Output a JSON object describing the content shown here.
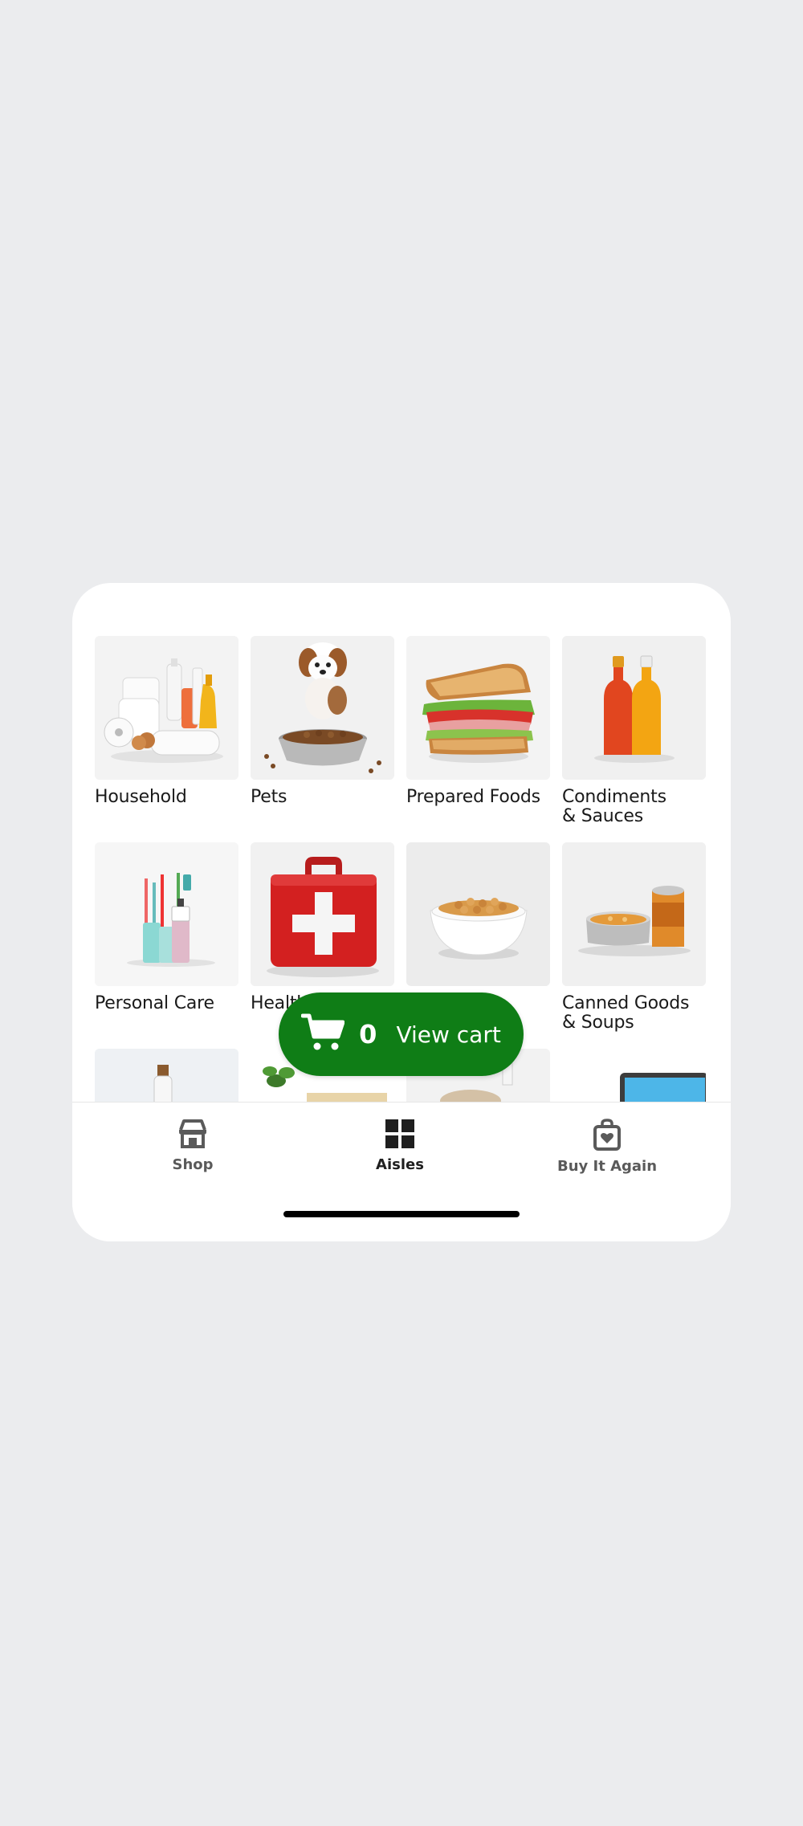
{
  "aisles": [
    {
      "label": "Household",
      "icon": "household-products-image"
    },
    {
      "label": "Pets",
      "icon": "puppy-with-food-bowl-image"
    },
    {
      "label": "Prepared Foods",
      "icon": "sandwich-image"
    },
    {
      "label": "Condiments\n& Sauces",
      "icon": "sauce-bottles-image"
    },
    {
      "label": "Personal Care",
      "icon": "toothbrushes-image"
    },
    {
      "label": "Health",
      "icon": "first-aid-kit-image"
    },
    {
      "label": "",
      "icon": "cereal-bowl-image"
    },
    {
      "label": "Canned Goods\n& Soups",
      "icon": "canned-goods-image"
    }
  ],
  "cart": {
    "count": "0",
    "label": "View cart",
    "color": "#0f7d16"
  },
  "tabbar": {
    "tabs": [
      {
        "label": "Shop",
        "icon": "storefront-icon"
      },
      {
        "label": "Aisles",
        "icon": "grid-icon"
      },
      {
        "label": "Buy It Again",
        "icon": "bag-heart-icon"
      }
    ]
  }
}
